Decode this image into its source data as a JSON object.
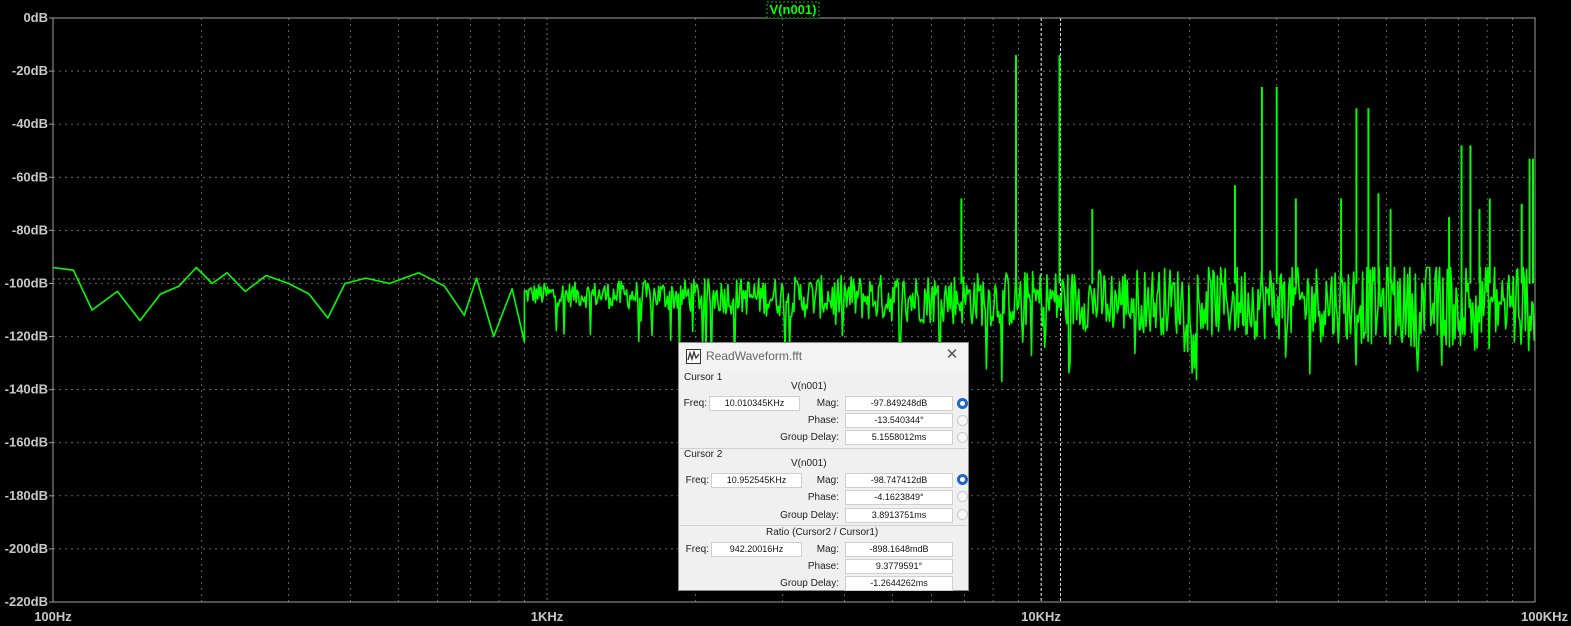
{
  "plot": {
    "trace_name": "V(n001)",
    "y_ticks": [
      "0dB",
      "-20dB",
      "-40dB",
      "-60dB",
      "-80dB",
      "-100dB",
      "-120dB",
      "-140dB",
      "-160dB",
      "-180dB",
      "-200dB",
      "-220dB"
    ],
    "x_ticks": [
      "100Hz",
      "1KHz",
      "10KHz",
      "100KHz"
    ],
    "background_color": "#000000",
    "grid_color": "#8c8c8c",
    "trace_color": "#00ff00",
    "cursor_color": "#e0e0e0"
  },
  "chart_data": {
    "type": "line",
    "title": "V(n001)",
    "x_scale": "log",
    "xlim_hz": [
      100,
      100000
    ],
    "ylim_db": [
      -220,
      0
    ],
    "x_tick_labels": [
      "100Hz",
      "1KHz",
      "10KHz",
      "100KHz"
    ],
    "y_tick_labels": [
      "0dB",
      "-20dB",
      "-40dB",
      "-60dB",
      "-80dB",
      "-100dB",
      "-120dB",
      "-140dB",
      "-160dB",
      "-180dB",
      "-200dB",
      "-220dB"
    ],
    "noise_floor_db": [
      -100,
      -112
    ],
    "series": [
      {
        "name": "V(n001)",
        "points": [
          [
            100,
            -94
          ],
          [
            110,
            -95
          ],
          [
            120,
            -110
          ],
          [
            135,
            -103
          ],
          [
            150,
            -114
          ],
          [
            165,
            -104
          ],
          [
            180,
            -101
          ],
          [
            195,
            -94
          ],
          [
            210,
            -100
          ],
          [
            225,
            -96
          ],
          [
            245,
            -103
          ],
          [
            270,
            -97
          ],
          [
            300,
            -100
          ],
          [
            330,
            -104
          ],
          [
            360,
            -113
          ],
          [
            390,
            -100
          ],
          [
            430,
            -98
          ],
          [
            480,
            -100
          ],
          [
            550,
            -96
          ],
          [
            620,
            -101
          ],
          [
            680,
            -112
          ],
          [
            720,
            -98
          ],
          [
            780,
            -120
          ],
          [
            850,
            -102
          ],
          [
            900,
            -122
          ]
        ],
        "spikes": [
          {
            "freq_hz": 6900,
            "db": -68
          },
          {
            "freq_hz": 8900,
            "db": -14
          },
          {
            "freq_hz": 10900,
            "db": -14
          },
          {
            "freq_hz": 12700,
            "db": -72
          },
          {
            "freq_hz": 24700,
            "db": -63
          },
          {
            "freq_hz": 28000,
            "db": -26
          },
          {
            "freq_hz": 30000,
            "db": -26
          },
          {
            "freq_hz": 32800,
            "db": -68
          },
          {
            "freq_hz": 40500,
            "db": -68
          },
          {
            "freq_hz": 43500,
            "db": -34
          },
          {
            "freq_hz": 46000,
            "db": -34
          },
          {
            "freq_hz": 48200,
            "db": -66
          },
          {
            "freq_hz": 51000,
            "db": -72
          },
          {
            "freq_hz": 67000,
            "db": -75
          },
          {
            "freq_hz": 71000,
            "db": -48
          },
          {
            "freq_hz": 74000,
            "db": -48
          },
          {
            "freq_hz": 77200,
            "db": -72
          },
          {
            "freq_hz": 81000,
            "db": -68
          },
          {
            "freq_hz": 94000,
            "db": -70
          },
          {
            "freq_hz": 97500,
            "db": -53
          },
          {
            "freq_hz": 100000,
            "db": -53
          }
        ]
      }
    ],
    "cursors_hz": [
      10010.345,
      10952.545
    ],
    "grid": true
  },
  "dialog": {
    "title": "ReadWaveform.fft",
    "cursor1": {
      "section": "Cursor 1",
      "trace": "V(n001)",
      "freq_label": "Freq:",
      "freq": "10.010345KHz",
      "mag_label": "Mag:",
      "mag": "-97.849248dB",
      "phase_label": "Phase:",
      "phase": "-13.540344°",
      "gd_label": "Group Delay:",
      "gd": "5.1558012ms"
    },
    "cursor2": {
      "section": "Cursor 2",
      "trace": "V(n001)",
      "freq_label": "Freq:",
      "freq": "10.952545KHz",
      "mag_label": "Mag:",
      "mag": "-98.747412dB",
      "phase_label": "Phase:",
      "phase": "-4.1623849°",
      "gd_label": "Group Delay:",
      "gd": "3.8913751ms"
    },
    "ratio": {
      "section": "Ratio (Cursor2 / Cursor1)",
      "freq_label": "Freq:",
      "freq": "942.20016Hz",
      "mag_label": "Mag:",
      "mag": "-898.1648mdB",
      "phase_label": "Phase:",
      "phase": "9.3779591°",
      "gd_label": "Group Delay:",
      "gd": "-1.2644262ms"
    }
  }
}
